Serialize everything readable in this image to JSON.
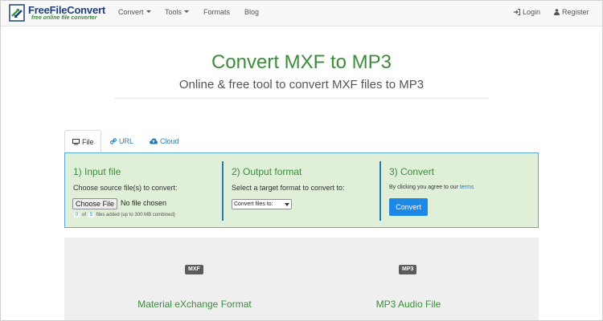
{
  "brand": {
    "name": "FreeFileConvert",
    "tagline": "free online file converter"
  },
  "nav": {
    "items": [
      {
        "label": "Convert",
        "dropdown": true
      },
      {
        "label": "Tools",
        "dropdown": true
      },
      {
        "label": "Formats",
        "dropdown": false
      },
      {
        "label": "Blog",
        "dropdown": false
      }
    ],
    "login": "Login",
    "register": "Register"
  },
  "hero": {
    "title": "Convert MXF to MP3",
    "subtitle": "Online & free tool to convert MXF files to MP3"
  },
  "tabs": [
    {
      "label": "File",
      "icon": "monitor-icon",
      "active": true
    },
    {
      "label": "URL",
      "icon": "link-icon",
      "active": false
    },
    {
      "label": "Cloud",
      "icon": "cloud-icon",
      "active": false
    }
  ],
  "steps": {
    "input": {
      "title": "1) Input file",
      "text": "Choose source file(s) to convert:",
      "choose_button": "Choose File",
      "no_file": "No file chosen",
      "files_count": "0",
      "files_max": "5",
      "of": "of",
      "files_suffix": "files added (up to 300 MB combined)"
    },
    "output": {
      "title": "2) Output format",
      "text": "Select a target format to convert to:",
      "select_value": "Convert files to:"
    },
    "convert": {
      "title": "3) Convert",
      "agree_text": "By clicking you agree to our",
      "terms": "terms",
      "button": "Convert"
    }
  },
  "formats": [
    {
      "badge": "MXF",
      "name": "Material eXchange Format"
    },
    {
      "badge": "MP3",
      "name": "MP3 Audio File"
    }
  ],
  "colors": {
    "accent_green": "#3c8c3c",
    "link_blue": "#2a7ab0",
    "panel_bg": "#dfefd8",
    "button_blue": "#1e88e5"
  }
}
